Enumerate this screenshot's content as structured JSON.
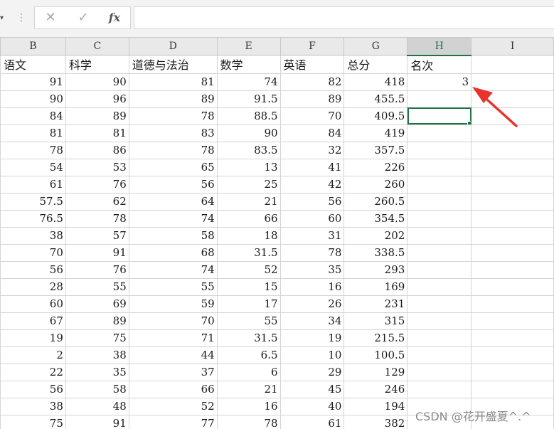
{
  "formula_bar": {
    "cancel_icon": "✕",
    "enter_icon": "✓",
    "fx_label": "fx",
    "formula_value": ""
  },
  "grid": {
    "columns": [
      "B",
      "C",
      "D",
      "E",
      "F",
      "G",
      "H",
      "I"
    ],
    "active_column": "H",
    "header_row": [
      "语文",
      "科学",
      "道德与法治",
      "数学",
      "英语",
      "总分",
      "名次",
      ""
    ],
    "rows": [
      [
        "91",
        "90",
        "81",
        "74",
        "82",
        "418",
        "3",
        ""
      ],
      [
        "90",
        "96",
        "89",
        "91.5",
        "89",
        "455.5",
        "",
        ""
      ],
      [
        "84",
        "89",
        "78",
        "88.5",
        "70",
        "409.5",
        "",
        ""
      ],
      [
        "81",
        "81",
        "83",
        "90",
        "84",
        "419",
        "",
        ""
      ],
      [
        "78",
        "86",
        "78",
        "83.5",
        "32",
        "357.5",
        "",
        ""
      ],
      [
        "54",
        "53",
        "65",
        "13",
        "41",
        "226",
        "",
        ""
      ],
      [
        "61",
        "76",
        "56",
        "25",
        "42",
        "260",
        "",
        ""
      ],
      [
        "57.5",
        "62",
        "64",
        "21",
        "56",
        "260.5",
        "",
        ""
      ],
      [
        "76.5",
        "78",
        "74",
        "66",
        "60",
        "354.5",
        "",
        ""
      ],
      [
        "38",
        "57",
        "58",
        "18",
        "31",
        "202",
        "",
        ""
      ],
      [
        "70",
        "91",
        "68",
        "31.5",
        "78",
        "338.5",
        "",
        ""
      ],
      [
        "56",
        "76",
        "74",
        "52",
        "35",
        "293",
        "",
        ""
      ],
      [
        "28",
        "55",
        "55",
        "15",
        "16",
        "169",
        "",
        ""
      ],
      [
        "60",
        "69",
        "59",
        "17",
        "26",
        "231",
        "",
        ""
      ],
      [
        "67",
        "89",
        "70",
        "55",
        "34",
        "315",
        "",
        ""
      ],
      [
        "19",
        "75",
        "71",
        "31.5",
        "19",
        "215.5",
        "",
        ""
      ],
      [
        "2",
        "38",
        "44",
        "6.5",
        "10",
        "100.5",
        "",
        ""
      ],
      [
        "22",
        "35",
        "37",
        "6",
        "29",
        "129",
        "",
        ""
      ],
      [
        "56",
        "58",
        "66",
        "21",
        "45",
        "246",
        "",
        ""
      ],
      [
        "38",
        "48",
        "52",
        "16",
        "40",
        "194",
        "",
        ""
      ],
      [
        "75",
        "91",
        "77",
        "78",
        "61",
        "382",
        "",
        ""
      ]
    ],
    "selected_cell": {
      "row": 2,
      "col": 6
    }
  },
  "annotation": {
    "arrow_color": "#e8322b"
  },
  "watermark": "CSDN @花开盛夏^.^"
}
